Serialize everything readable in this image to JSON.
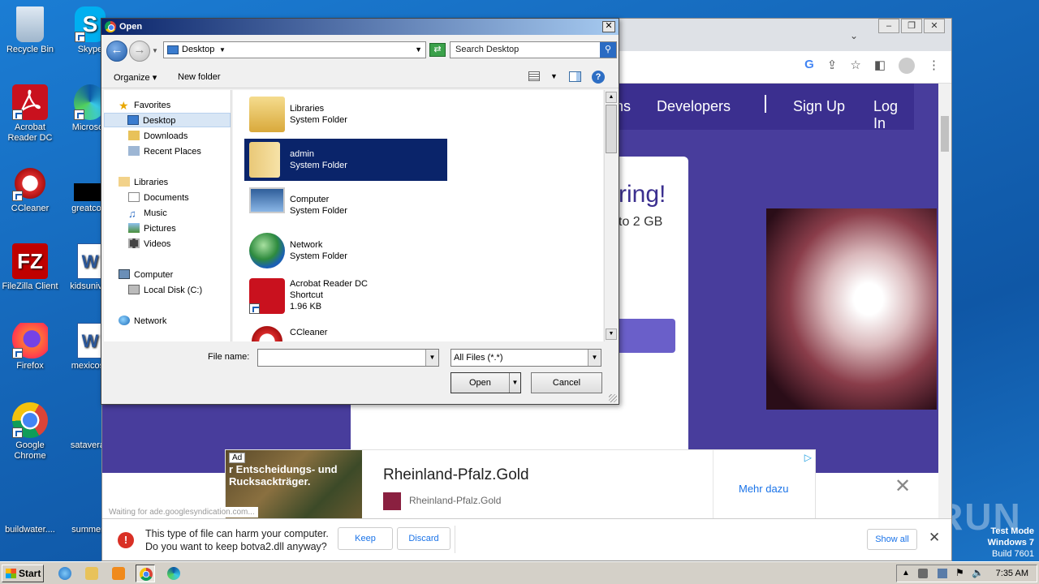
{
  "desktop": {
    "icons": [
      {
        "label": "Recycle Bin"
      },
      {
        "label": "Skype"
      },
      {
        "label": "Acrobat Reader DC"
      },
      {
        "label": "Microsoft"
      },
      {
        "label": "CCleaner"
      },
      {
        "label": "greatcom"
      },
      {
        "label": "FileZilla Client"
      },
      {
        "label": "kidsuniver"
      },
      {
        "label": "Firefox"
      },
      {
        "label": "mexicose"
      },
      {
        "label": "Google Chrome"
      },
      {
        "label": "sataverag"
      },
      {
        "label": "buildwater...."
      },
      {
        "label": "summerg"
      }
    ],
    "watermark": "ANY RUN",
    "test_mode": {
      "line1": "Test Mode",
      "line2": "Windows 7",
      "line3": "Build 7601"
    }
  },
  "browser": {
    "site_nav": {
      "item1": "ns",
      "item2": "Developers",
      "item3": "Sign Up",
      "item4": "Log In"
    },
    "card": {
      "headline": "ring!",
      "subline": "to 2 GB"
    },
    "ad": {
      "tag": "Ad",
      "image_text": "r Entscheidungs- und Rucksackträger.",
      "title": "Rheinland-Pfalz.Gold",
      "source": "Rheinland-Pfalz.Gold",
      "more": "Mehr dazu"
    },
    "status": "Waiting for ade.googlesyndication.com...",
    "download": {
      "line1": "This type of file can harm your computer.",
      "line2": "Do you want to keep botva2.dll anyway?",
      "keep": "Keep",
      "discard": "Discard",
      "show_all": "Show all"
    }
  },
  "dialog": {
    "title": "Open",
    "address": "Desktop",
    "search_placeholder": "Search Desktop",
    "organize": "Organize",
    "new_folder": "New folder",
    "nav": {
      "favorites": "Favorites",
      "desktop": "Desktop",
      "downloads": "Downloads",
      "recent": "Recent Places",
      "libraries": "Libraries",
      "documents": "Documents",
      "music": "Music",
      "pictures": "Pictures",
      "videos": "Videos",
      "computer": "Computer",
      "local_disk": "Local Disk (C:)",
      "network": "Network"
    },
    "files": [
      {
        "name": "Libraries",
        "type": "System Folder",
        "size": ""
      },
      {
        "name": "admin",
        "type": "System Folder",
        "size": ""
      },
      {
        "name": "Computer",
        "type": "System Folder",
        "size": ""
      },
      {
        "name": "Network",
        "type": "System Folder",
        "size": ""
      },
      {
        "name": "Acrobat Reader DC",
        "type": "Shortcut",
        "size": "1.96 KB"
      },
      {
        "name": "CCleaner",
        "type": "",
        "size": ""
      }
    ],
    "file_name_label": "File name:",
    "file_name_value": "",
    "filter": "All Files (*.*)",
    "open": "Open",
    "cancel": "Cancel"
  },
  "taskbar": {
    "start": "Start",
    "clock": "7:35 AM"
  }
}
